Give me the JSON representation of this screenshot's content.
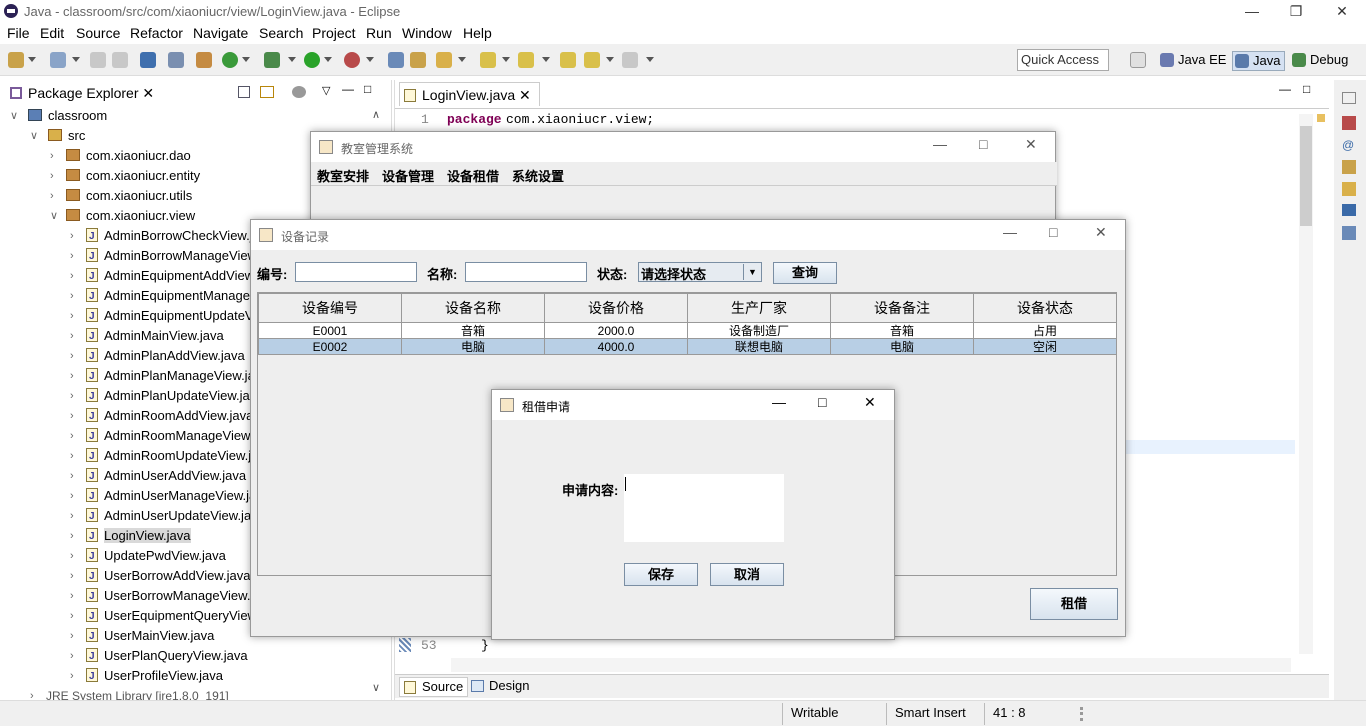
{
  "window": {
    "title": "Java - classroom/src/com/xiaoniucr/view/LoginView.java - Eclipse"
  },
  "menu": [
    "File",
    "Edit",
    "Source",
    "Refactor",
    "Navigate",
    "Search",
    "Project",
    "Run",
    "Window",
    "Help"
  ],
  "toolbar": {
    "quick_access": "Quick Access",
    "perspectives": [
      "Java EE",
      "Java",
      "Debug"
    ]
  },
  "package_explorer": {
    "title": "Package Explorer",
    "project": "classroom",
    "src": "src",
    "packages": [
      "com.xiaoniucr.dao",
      "com.xiaoniucr.entity",
      "com.xiaoniucr.utils",
      "com.xiaoniucr.view"
    ],
    "files": [
      "AdminBorrowCheckView.java",
      "AdminBorrowManageView.java",
      "AdminEquipmentAddView.java",
      "AdminEquipmentManageView.java",
      "AdminEquipmentUpdateView.java",
      "AdminMainView.java",
      "AdminPlanAddView.java",
      "AdminPlanManageView.java",
      "AdminPlanUpdateView.java",
      "AdminRoomAddView.java",
      "AdminRoomManageView.java",
      "AdminRoomUpdateView.java",
      "AdminUserAddView.java",
      "AdminUserManageView.java",
      "AdminUserUpdateView.java",
      "LoginView.java",
      "UpdatePwdView.java",
      "UserBorrowAddView.java",
      "UserBorrowManageView.java",
      "UserEquipmentQueryView.java",
      "UserMainView.java",
      "UserPlanQueryView.java",
      "UserProfileView.java"
    ],
    "jre": "JRE System Library [jre1.8.0_191]"
  },
  "editor": {
    "tab": "LoginView.java",
    "line1_no": "1",
    "line1_kw": "package",
    "line1_rest": " com.xiaoniucr.view;",
    "line53_no": "53",
    "line53_code": "}",
    "bottom_tabs": [
      "Source",
      "Design"
    ]
  },
  "status": {
    "writable": "Writable",
    "insert": "Smart Insert",
    "position": "41 : 8"
  },
  "main_window": {
    "title": "教室管理系统",
    "menu": [
      "教室安排",
      "设备管理",
      "设备租借",
      "系统设置"
    ]
  },
  "equipment_window": {
    "title": "设备记录",
    "code_label": "编号:",
    "name_label": "名称:",
    "status_label": "状态:",
    "status_value": "请选择状态",
    "query_button": "查询",
    "columns": [
      "设备编号",
      "设备名称",
      "设备价格",
      "生产厂家",
      "设备备注",
      "设备状态"
    ],
    "rows": [
      [
        "E0001",
        "音箱",
        "2000.0",
        "设备制造厂",
        "音箱",
        "占用"
      ],
      [
        "E0002",
        "电脑",
        "4000.0",
        "联想电脑",
        "电脑",
        "空闲"
      ]
    ],
    "borrow_button": "租借"
  },
  "borrow_dialog": {
    "title": "租借申请",
    "content_label": "申请内容:",
    "save_button": "保存",
    "cancel_button": "取消"
  }
}
